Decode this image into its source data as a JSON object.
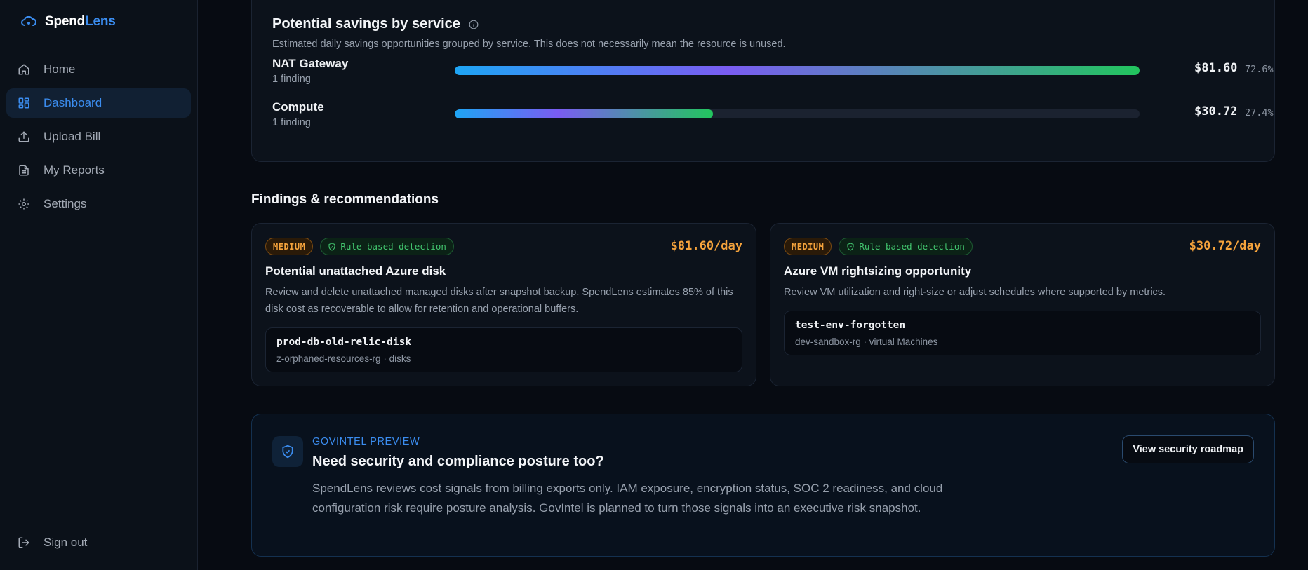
{
  "brand": {
    "name_part1": "Spend",
    "name_part2": "Lens",
    "logo_icon": "cloud-dollar-icon",
    "accent": "#3b8df0"
  },
  "sidebar": {
    "items": [
      {
        "label": "Home",
        "icon": "home-icon",
        "active": false
      },
      {
        "label": "Dashboard",
        "icon": "dashboard-grid-icon",
        "active": true
      },
      {
        "label": "Upload Bill",
        "icon": "upload-icon",
        "active": false
      },
      {
        "label": "My Reports",
        "icon": "document-icon",
        "active": false
      },
      {
        "label": "Settings",
        "icon": "gear-icon",
        "active": false
      }
    ],
    "signout": {
      "label": "Sign out",
      "icon": "sign-out-icon"
    }
  },
  "savings": {
    "title": "Potential savings by service",
    "subtitle": "Estimated daily savings opportunities grouped by service. This does not necessarily mean the resource is unused.",
    "services": [
      {
        "name": "NAT Gateway",
        "count": "1 finding",
        "amount": "$81.60",
        "percent": "72.6%",
        "fraction": 1.0
      },
      {
        "name": "Compute",
        "count": "1 finding",
        "amount": "$30.72",
        "percent": "27.4%",
        "fraction": 0.377
      }
    ],
    "bar_gradient": [
      "#1ea5f5",
      "#7a5cf2",
      "#22c55e"
    ]
  },
  "findings": {
    "title": "Findings & recommendations",
    "items": [
      {
        "severity": "MEDIUM",
        "detection": "Rule-based detection",
        "cost": "$81.60/day",
        "title": "Potential unattached Azure disk",
        "description": "Review and delete unattached managed disks after snapshot backup. SpendLens estimates 85% of this disk cost as recoverable to allow for retention and operational buffers.",
        "resource": {
          "name": "prod-db-old-relic-disk",
          "meta": "z-orphaned-resources-rg · disks"
        }
      },
      {
        "severity": "MEDIUM",
        "detection": "Rule-based detection",
        "cost": "$30.72/day",
        "title": "Azure VM rightsizing opportunity",
        "description": "Review VM utilization and right-size or adjust schedules where supported by metrics.",
        "resource": {
          "name": "test-env-forgotten",
          "meta": "dev-sandbox-rg · virtual Machines"
        }
      }
    ]
  },
  "govintel": {
    "label": "GOVINTEL PREVIEW",
    "title": "Need security and compliance posture too?",
    "description": "SpendLens reviews cost signals from billing exports only. IAM exposure, encryption status, SOC 2 readiness, and cloud configuration risk require posture analysis. GovIntel is planned to turn those signals into an executive risk snapshot.",
    "button": "View security roadmap",
    "icon": "shield-check-icon"
  }
}
